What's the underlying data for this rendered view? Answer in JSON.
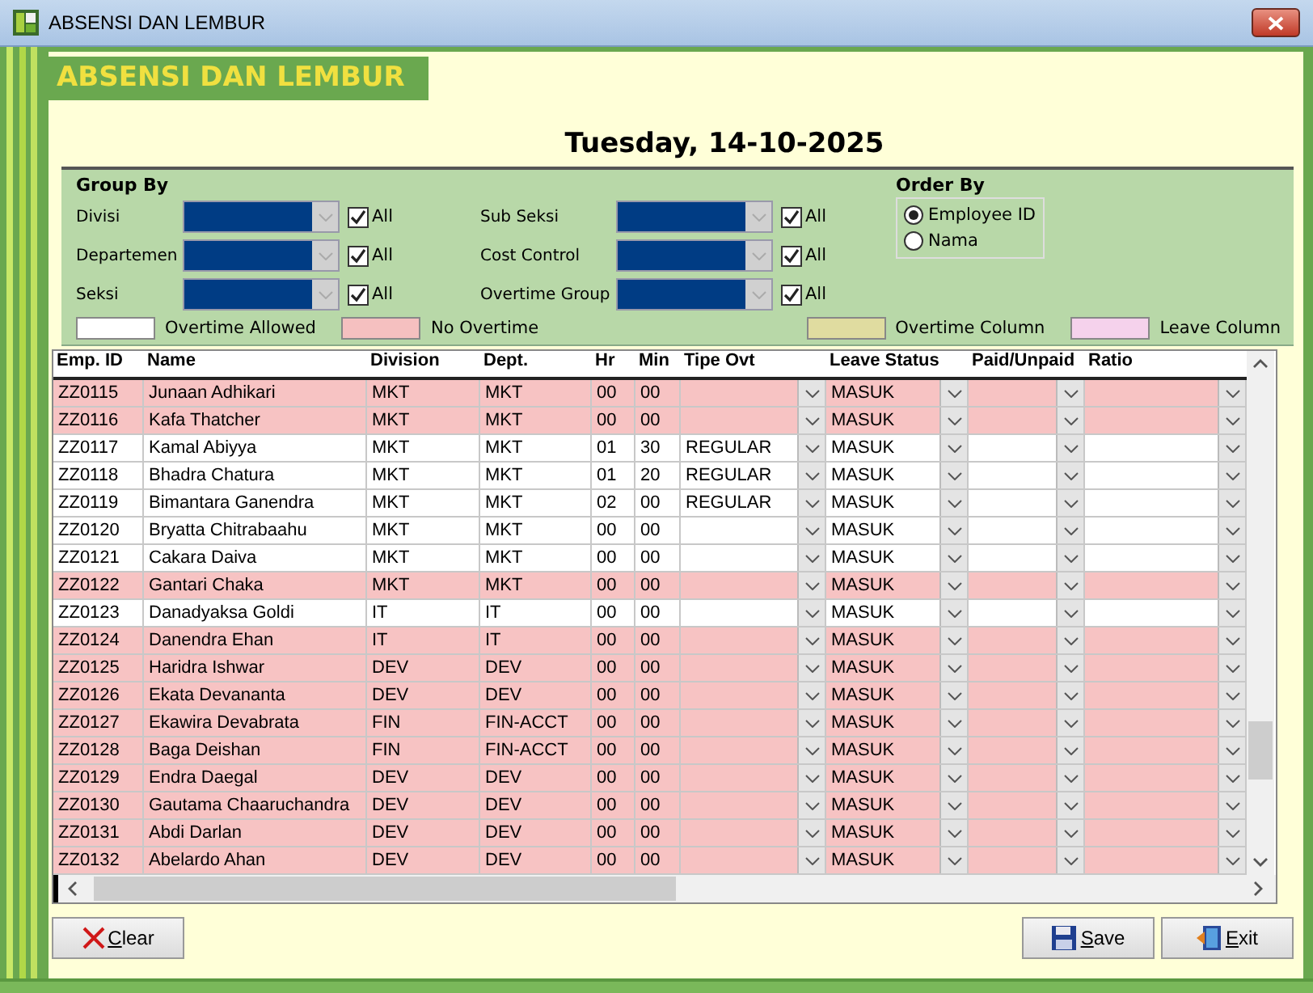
{
  "window": {
    "title": "ABSENSI DAN LEMBUR"
  },
  "header": {
    "title": "ABSENSI DAN LEMBUR",
    "date": "Tuesday, 14-10-2025"
  },
  "group_by": {
    "title": "Group By",
    "filters": [
      {
        "label": "Divisi",
        "all_label": "All",
        "all_checked": true
      },
      {
        "label": "Departemen",
        "all_label": "All",
        "all_checked": true
      },
      {
        "label": "Seksi",
        "all_label": "All",
        "all_checked": true
      },
      {
        "label": "Sub Seksi",
        "all_label": "All",
        "all_checked": true
      },
      {
        "label": "Cost Control",
        "all_label": "All",
        "all_checked": true
      },
      {
        "label": "Overtime Group",
        "all_label": "All",
        "all_checked": true
      }
    ]
  },
  "order_by": {
    "title": "Order By",
    "options": [
      {
        "label": "Employee ID",
        "selected": true
      },
      {
        "label": "Nama",
        "selected": false
      }
    ]
  },
  "legend": [
    {
      "label": "Overtime Allowed",
      "color": "#ffffff"
    },
    {
      "label": "No Overtime",
      "color": "#f5c0c0"
    },
    {
      "label": "Overtime Column",
      "color": "#e0dca0"
    },
    {
      "label": "Leave Column",
      "color": "#f5d2ec"
    }
  ],
  "table": {
    "columns": [
      "Emp. ID",
      "Name",
      "Division",
      "Dept.",
      "Hr",
      "Min",
      "Tipe Ovt",
      "Leave Status",
      "Paid/Unpaid",
      "Ratio"
    ],
    "rows": [
      {
        "emp_id": "ZZ0115",
        "name": "Junaan Adhikari",
        "division": "MKT",
        "dept": "MKT",
        "hr": "00",
        "min": "00",
        "tipe_ovt": "",
        "leave_status": "MASUK",
        "overtime_allowed": false
      },
      {
        "emp_id": "ZZ0116",
        "name": "Kafa Thatcher",
        "division": "MKT",
        "dept": "MKT",
        "hr": "00",
        "min": "00",
        "tipe_ovt": "",
        "leave_status": "MASUK",
        "overtime_allowed": false
      },
      {
        "emp_id": "ZZ0117",
        "name": "Kamal Abiyya",
        "division": "MKT",
        "dept": "MKT",
        "hr": "01",
        "min": "30",
        "tipe_ovt": "REGULAR",
        "leave_status": "MASUK",
        "overtime_allowed": true
      },
      {
        "emp_id": "ZZ0118",
        "name": "Bhadra Chatura",
        "division": "MKT",
        "dept": "MKT",
        "hr": "01",
        "min": "20",
        "tipe_ovt": "REGULAR",
        "leave_status": "MASUK",
        "overtime_allowed": true
      },
      {
        "emp_id": "ZZ0119",
        "name": "Bimantara Ganendra",
        "division": "MKT",
        "dept": "MKT",
        "hr": "02",
        "min": "00",
        "tipe_ovt": "REGULAR",
        "leave_status": "MASUK",
        "overtime_allowed": true
      },
      {
        "emp_id": "ZZ0120",
        "name": "Bryatta Chitrabaahu",
        "division": "MKT",
        "dept": "MKT",
        "hr": "00",
        "min": "00",
        "tipe_ovt": "",
        "leave_status": "MASUK",
        "overtime_allowed": true
      },
      {
        "emp_id": "ZZ0121",
        "name": "Cakara Daiva",
        "division": "MKT",
        "dept": "MKT",
        "hr": "00",
        "min": "00",
        "tipe_ovt": "",
        "leave_status": "MASUK",
        "overtime_allowed": true
      },
      {
        "emp_id": "ZZ0122",
        "name": "Gantari Chaka",
        "division": "MKT",
        "dept": "MKT",
        "hr": "00",
        "min": "00",
        "tipe_ovt": "",
        "leave_status": "MASUK",
        "overtime_allowed": false
      },
      {
        "emp_id": "ZZ0123",
        "name": "Danadyaksa Goldi",
        "division": "IT",
        "dept": "IT",
        "hr": "00",
        "min": "00",
        "tipe_ovt": "",
        "leave_status": "MASUK",
        "overtime_allowed": true
      },
      {
        "emp_id": "ZZ0124",
        "name": "Danendra Ehan",
        "division": "IT",
        "dept": "IT",
        "hr": "00",
        "min": "00",
        "tipe_ovt": "",
        "leave_status": "MASUK",
        "overtime_allowed": false
      },
      {
        "emp_id": "ZZ0125",
        "name": "Haridra Ishwar",
        "division": "DEV",
        "dept": "DEV",
        "hr": "00",
        "min": "00",
        "tipe_ovt": "",
        "leave_status": "MASUK",
        "overtime_allowed": false
      },
      {
        "emp_id": "ZZ0126",
        "name": "Ekata Devananta",
        "division": "DEV",
        "dept": "DEV",
        "hr": "00",
        "min": "00",
        "tipe_ovt": "",
        "leave_status": "MASUK",
        "overtime_allowed": false
      },
      {
        "emp_id": "ZZ0127",
        "name": "Ekawira Devabrata",
        "division": "FIN",
        "dept": "FIN-ACCT",
        "hr": "00",
        "min": "00",
        "tipe_ovt": "",
        "leave_status": "MASUK",
        "overtime_allowed": false
      },
      {
        "emp_id": "ZZ0128",
        "name": "Baga Deishan",
        "division": "FIN",
        "dept": "FIN-ACCT",
        "hr": "00",
        "min": "00",
        "tipe_ovt": "",
        "leave_status": "MASUK",
        "overtime_allowed": false
      },
      {
        "emp_id": "ZZ0129",
        "name": "Endra Daegal",
        "division": "DEV",
        "dept": "DEV",
        "hr": "00",
        "min": "00",
        "tipe_ovt": "",
        "leave_status": "MASUK",
        "overtime_allowed": false
      },
      {
        "emp_id": "ZZ0130",
        "name": "Gautama Chaaruchandra",
        "division": "DEV",
        "dept": "DEV",
        "hr": "00",
        "min": "00",
        "tipe_ovt": "",
        "leave_status": "MASUK",
        "overtime_allowed": false
      },
      {
        "emp_id": "ZZ0131",
        "name": "Abdi Darlan",
        "division": "DEV",
        "dept": "DEV",
        "hr": "00",
        "min": "00",
        "tipe_ovt": "",
        "leave_status": "MASUK",
        "overtime_allowed": false
      },
      {
        "emp_id": "ZZ0132",
        "name": "Abelardo Ahan",
        "division": "DEV",
        "dept": "DEV",
        "hr": "00",
        "min": "00",
        "tipe_ovt": "",
        "leave_status": "MASUK",
        "overtime_allowed": false
      }
    ]
  },
  "buttons": [
    {
      "label": "Clear",
      "kind": "clear"
    },
    {
      "label": "Save",
      "kind": "save"
    },
    {
      "label": "Exit",
      "kind": "exit"
    }
  ]
}
